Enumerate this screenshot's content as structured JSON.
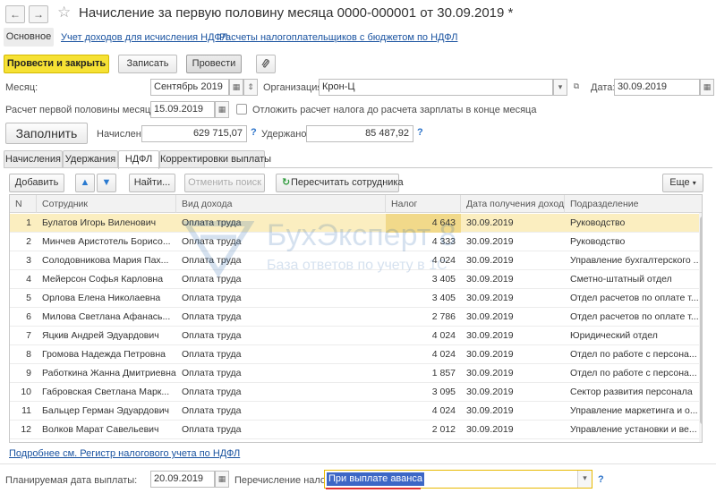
{
  "window": {
    "title": "Начисление за первую половину месяца 0000-000001 от 30.09.2019 *",
    "back_glyph": "←",
    "forward_glyph": "→",
    "star_glyph": "☆"
  },
  "sections": {
    "main": "Основное",
    "links": [
      "Учет доходов для исчисления НДФЛ",
      "Расчеты налогоплательщиков с бюджетом по НДФЛ"
    ]
  },
  "toolbar": {
    "post_close": "Провести и закрыть",
    "write": "Записать",
    "post": "Провести",
    "attach_icon": "paperclip-icon"
  },
  "header": {
    "month_label": "Месяц:",
    "month_value": "Сентябрь 2019",
    "org_label": "Организация:",
    "org_value": "Крон-Ц",
    "date_label": "Дата:",
    "date_value": "30.09.2019",
    "calc_label": "Расчет первой половины месяца до:",
    "calc_value": "15.09.2019",
    "defer_label": "Отложить расчет налога до расчета зарплаты в конце месяца",
    "defer_checked": false
  },
  "summary": {
    "fill_button": "Заполнить",
    "accrued_label": "Начислено:",
    "accrued_value": "629 715,07",
    "withheld_label": "Удержано:",
    "withheld_value": "85 487,92",
    "help": "?"
  },
  "tabs": [
    "Начисления",
    "Удержания",
    "НДФЛ",
    "Корректировки выплаты"
  ],
  "active_tab": 2,
  "table_toolbar": {
    "add": "Добавить",
    "find": "Найти...",
    "cancel_search": "Отменить поиск",
    "recalc": "Пересчитать сотрудника",
    "more": "Еще"
  },
  "table": {
    "columns": [
      "N",
      "Сотрудник",
      "Вид дохода",
      "Налог",
      "Дата получения дохода",
      "Подразделение"
    ],
    "rows": [
      [
        "1",
        "Булатов Игорь Виленович",
        "Оплата труда",
        "4 643",
        "30.09.2019",
        "Руководство"
      ],
      [
        "2",
        "Минчев Аристотель Борисо...",
        "Оплата труда",
        "4 333",
        "30.09.2019",
        "Руководство"
      ],
      [
        "3",
        "Солодовникова Мария Пах...",
        "Оплата труда",
        "4 024",
        "30.09.2019",
        "Управление бухгалтерского ..."
      ],
      [
        "4",
        "Мейерсон Софья Карловна",
        "Оплата труда",
        "3 405",
        "30.09.2019",
        "Сметно-штатный отдел"
      ],
      [
        "5",
        "Орлова Елена Николаевна",
        "Оплата труда",
        "3 405",
        "30.09.2019",
        "Отдел расчетов по оплате т..."
      ],
      [
        "6",
        "Милова Светлана Афанась...",
        "Оплата труда",
        "2 786",
        "30.09.2019",
        "Отдел расчетов по оплате т..."
      ],
      [
        "7",
        "Яцкив Андрей Эдуардович",
        "Оплата труда",
        "4 024",
        "30.09.2019",
        "Юридический отдел"
      ],
      [
        "8",
        "Громова Надежда Петровна",
        "Оплата труда",
        "4 024",
        "30.09.2019",
        "Отдел по работе с персона..."
      ],
      [
        "9",
        "Работкина Жанна Дмитриевна",
        "Оплата труда",
        "1 857",
        "30.09.2019",
        "Отдел по работе с персона..."
      ],
      [
        "10",
        "Габровская Светлана Марк...",
        "Оплата труда",
        "3 095",
        "30.09.2019",
        "Сектор развития персонала"
      ],
      [
        "11",
        "Бальцер Герман Эдуардович",
        "Оплата труда",
        "4 024",
        "30.09.2019",
        "Управление маркетинга и о..."
      ],
      [
        "12",
        "Волков Марат Савельевич",
        "Оплата труда",
        "2 012",
        "30.09.2019",
        "Управление установки и ве..."
      ]
    ],
    "selected_row": 0
  },
  "watermark": {
    "brand": "БухЭксперт 8",
    "tagline": "База ответов по учету в 1С"
  },
  "register_link": "Подробнее см. Регистр налогового учета по НДФЛ",
  "footer": {
    "pay_date_label": "Планируемая дата выплаты:",
    "pay_date_value": "20.09.2019",
    "transfer_label": "Перечисление налога:",
    "transfer_value": "При выплате аванса",
    "help": "?"
  },
  "colors": {
    "primary_button": "#f6e134",
    "selected_row": "#fbeec0",
    "link": "#1a53a0",
    "highlight_border": "#e8b900",
    "selection": "#3d67c6",
    "underline": "#e23030"
  }
}
